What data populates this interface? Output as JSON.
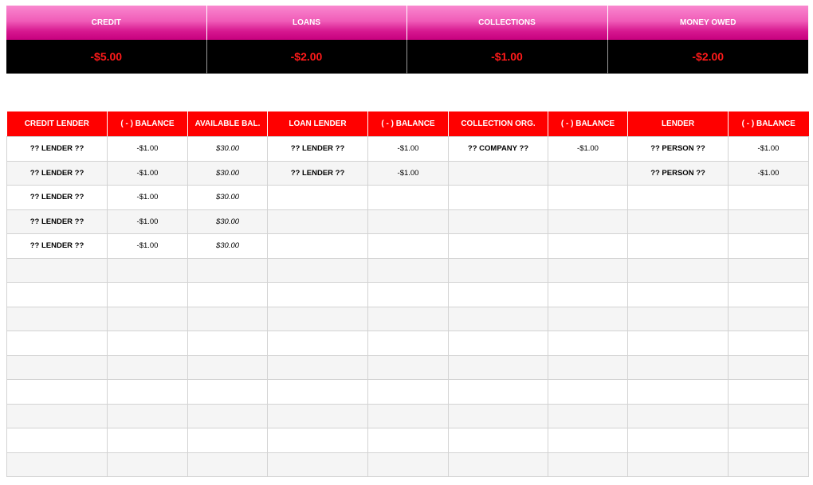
{
  "summary": {
    "columns": [
      {
        "label": "CREDIT",
        "value": "-$5.00"
      },
      {
        "label": "LOANS",
        "value": "-$2.00"
      },
      {
        "label": "COLLECTIONS",
        "value": "-$1.00"
      },
      {
        "label": "MONEY OWED",
        "value": "-$2.00"
      }
    ]
  },
  "ledger": {
    "headers": [
      "CREDIT LENDER",
      "( - ) BALANCE",
      "AVAILABLE BAL.",
      "LOAN LENDER",
      "( - ) BALANCE",
      "COLLECTION ORG.",
      "( - ) BALANCE",
      "LENDER",
      "( - ) BALANCE"
    ],
    "rows": [
      [
        "?? LENDER ??",
        "-$1.00",
        "$30.00",
        "?? LENDER ??",
        "-$1.00",
        "?? COMPANY ??",
        "-$1.00",
        "?? PERSON ??",
        "-$1.00"
      ],
      [
        "?? LENDER ??",
        "-$1.00",
        "$30.00",
        "?? LENDER ??",
        "-$1.00",
        "",
        "",
        "?? PERSON ??",
        "-$1.00"
      ],
      [
        "?? LENDER ??",
        "-$1.00",
        "$30.00",
        "",
        "",
        "",
        "",
        "",
        ""
      ],
      [
        "?? LENDER ??",
        "-$1.00",
        "$30.00",
        "",
        "",
        "",
        "",
        "",
        ""
      ],
      [
        "?? LENDER ??",
        "-$1.00",
        "$30.00",
        "",
        "",
        "",
        "",
        "",
        ""
      ],
      [
        "",
        "",
        "",
        "",
        "",
        "",
        "",
        "",
        ""
      ],
      [
        "",
        "",
        "",
        "",
        "",
        "",
        "",
        "",
        ""
      ],
      [
        "",
        "",
        "",
        "",
        "",
        "",
        "",
        "",
        ""
      ],
      [
        "",
        "",
        "",
        "",
        "",
        "",
        "",
        "",
        ""
      ],
      [
        "",
        "",
        "",
        "",
        "",
        "",
        "",
        "",
        ""
      ],
      [
        "",
        "",
        "",
        "",
        "",
        "",
        "",
        "",
        ""
      ],
      [
        "",
        "",
        "",
        "",
        "",
        "",
        "",
        "",
        ""
      ],
      [
        "",
        "",
        "",
        "",
        "",
        "",
        "",
        "",
        ""
      ],
      [
        "",
        "",
        "",
        "",
        "",
        "",
        "",
        "",
        ""
      ]
    ]
  }
}
